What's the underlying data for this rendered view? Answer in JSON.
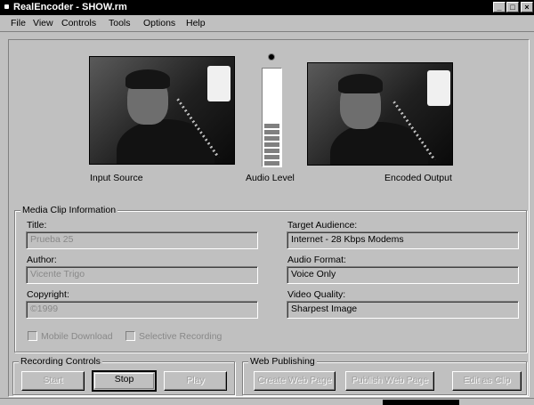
{
  "window": {
    "title": "RealEncoder - SHOW.rm"
  },
  "titlebar": {
    "minimize_glyph": "_",
    "maximize_glyph": "□",
    "close_glyph": "×"
  },
  "menu": {
    "items": [
      "File",
      "View",
      "Controls",
      "Tools",
      "Options",
      "Help"
    ]
  },
  "video": {
    "input_label": "Input Source",
    "audio_label": "Audio Level",
    "output_label": "Encoded Output",
    "audio_level_fraction": 0.37
  },
  "media_clip": {
    "group_title": "Media Clip Information",
    "title_label": "Title:",
    "title_value": "Prueba 25",
    "author_label": "Author:",
    "author_value": "Vicente Trigo",
    "copyright_label": "Copyright:",
    "copyright_value": "©1999",
    "target_label": "Target Audience:",
    "target_value": "Internet - 28 Kbps Modems",
    "audio_format_label": "Audio Format:",
    "audio_format_value": "Voice Only",
    "video_quality_label": "Video Quality:",
    "video_quality_value": "Sharpest Image",
    "mobile_download_label": "Mobile Download",
    "selective_recording_label": "Selective Recording"
  },
  "recording": {
    "group_title": "Recording Controls",
    "start_label": "Start",
    "stop_label": "Stop",
    "play_label": "Play"
  },
  "web_publishing": {
    "group_title": "Web Publishing",
    "create_label": "Create Web Page",
    "publish_label": "Publish Web Page",
    "edit_label": "Edit as Clip"
  },
  "icons": [
    "app-icon",
    "level-knob-icon"
  ],
  "colors": {
    "face": "#c0c0c0",
    "titlebar": "#000000",
    "disabled_text": "#888888"
  }
}
